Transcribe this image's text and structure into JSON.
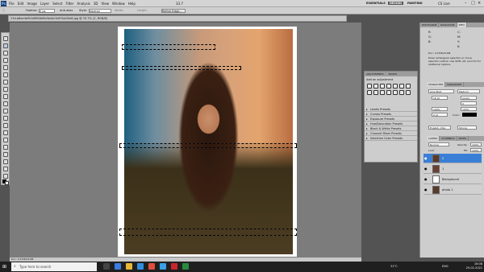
{
  "menubar": {
    "app_icon": "Ps",
    "menus": [
      "File",
      "Edit",
      "Image",
      "Layer",
      "Select",
      "Filter",
      "Analysis",
      "3D",
      "View",
      "Window",
      "Help"
    ],
    "zoom": "33.7",
    "workspaces": [
      "ESSENTIALS",
      "DESIGN",
      "PAINTING"
    ],
    "cs_live": "CS Live"
  },
  "options": {
    "feather_label": "Feather:",
    "feather_value": "0 px",
    "anti_alias": "Anti-alias",
    "style_label": "Style:",
    "style_value": "Normal",
    "width_label": "Width:",
    "height_label": "Height:",
    "refine": "Refine Edge..."
  },
  "document": {
    "tab_title": "23d-b8ee4ef54d9658d9e5b44c9d97bb30e6.jpg @ 33.7% (2, RGB/8)",
    "status": "Doc: 4.27M/29.6M"
  },
  "info_panel": {
    "tabs": [
      "HISTOGRAM",
      "NAVIGATOR",
      "INFO"
    ],
    "r": "R:",
    "g": "G:",
    "b": "B:",
    "c": "C:",
    "m": "M:",
    "y": "Y:",
    "k": "K:",
    "doc": "Doc: 4.27M/29.6M",
    "help": "Draw rectangular selection or move selection outline. Use Shift, Alt, and Ctrl for additional options."
  },
  "adjustments": {
    "tabs": [
      "ADJUSTMENTS",
      "MASKS"
    ],
    "title": "Add an adjustment",
    "presets": [
      "Levels Presets",
      "Curves Presets",
      "Exposure Presets",
      "Hue/Saturation Presets",
      "Black & White Presets",
      "Channel Mixer Presets",
      "Selective Color Presets"
    ]
  },
  "character": {
    "tabs": [
      "CHARACTER",
      "PARAGRAPH"
    ],
    "font": "Arial Bold",
    "style": "Medium",
    "size": "16 pt",
    "leading": "(Auto)",
    "tracking": "0",
    "scale_v": "100%",
    "scale_h": "100%",
    "baseline": "0 pt",
    "color_label": "Color:",
    "language": "English: USA",
    "aa": "Strong"
  },
  "layers": {
    "tabs": [
      "LAYERS",
      "CHANNELS",
      "PATHS"
    ],
    "blend": "Normal",
    "opacity_label": "Opacity:",
    "opacity": "100%",
    "lock_label": "Lock:",
    "fill_label": "Fill:",
    "fill": "100%",
    "items": [
      "2",
      "1",
      "Background",
      "photo 1"
    ]
  },
  "taskbar": {
    "search": "Type here to search",
    "temp": "31°C",
    "lang": "ENG",
    "time": "16:08",
    "date": "29-02-2021"
  }
}
